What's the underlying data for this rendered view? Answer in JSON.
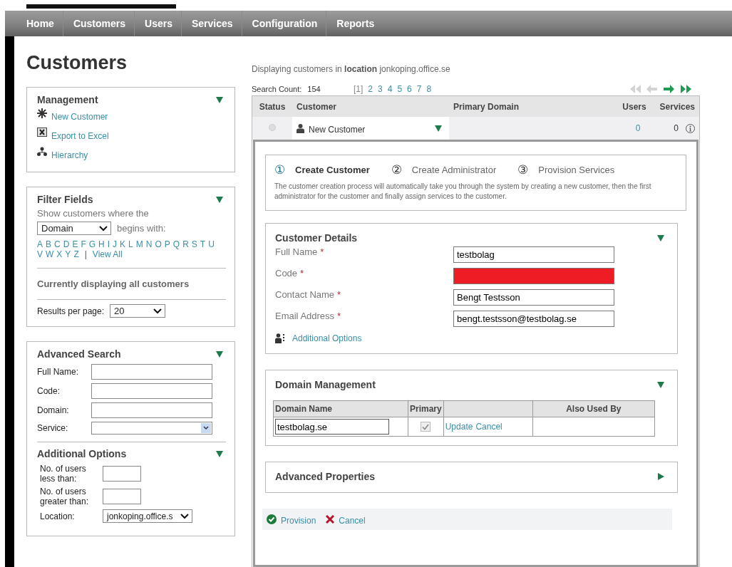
{
  "nav": {
    "items": [
      {
        "label": "Home"
      },
      {
        "label": "Customers"
      },
      {
        "label": "Users"
      },
      {
        "label": "Services"
      },
      {
        "label": "Configuration"
      },
      {
        "label": "Reports"
      }
    ]
  },
  "page_title": "Customers",
  "management": {
    "title": "Management",
    "expanded": true,
    "items": [
      {
        "label": "New Customer",
        "kind": "new"
      },
      {
        "label": "Export to Excel",
        "kind": "excel"
      },
      {
        "label": "Hierarchy",
        "kind": "hierarchy"
      }
    ]
  },
  "filter": {
    "title": "Filter Fields",
    "expanded": true,
    "intro": "Show customers where the",
    "field": "Domain",
    "condition": "begins with:",
    "letters": [
      "A",
      "B",
      "C",
      "D",
      "E",
      "F",
      "G",
      "H",
      "I",
      "J",
      "K",
      "L",
      "M",
      "N",
      "O",
      "P",
      "Q",
      "R",
      "S",
      "T",
      "U",
      "V",
      "W",
      "X",
      "Y",
      "Z"
    ],
    "separator": "|",
    "view_all": "View All",
    "status": "Currently displaying all customers",
    "results_label": "Results per page:",
    "results_value": "20"
  },
  "advanced_search": {
    "title": "Advanced Search",
    "expanded": true,
    "fields": [
      {
        "label": "Full Name:",
        "kind": "text"
      },
      {
        "label": "Code:",
        "kind": "text"
      },
      {
        "label": "Domain:",
        "kind": "text"
      },
      {
        "label": "Service:",
        "kind": "select"
      }
    ],
    "additional": {
      "title": "Additional Options",
      "expanded": true,
      "fields": [
        {
          "label": "No. of users less than:",
          "kind": "small"
        },
        {
          "label": "No. of users greater than:",
          "kind": "small"
        },
        {
          "label": "Location:",
          "kind": "select",
          "value": "jonkoping.office.s"
        }
      ]
    }
  },
  "location_text": "Displaying customers in **location** jonkoping.office.se",
  "search_count": {
    "label": "Search Count:",
    "value": "154"
  },
  "pages": [
    {
      "label": "[1]",
      "selected": true
    },
    {
      "label": "2",
      "selected": false
    },
    {
      "label": "3",
      "selected": false
    },
    {
      "label": "4",
      "selected": false
    },
    {
      "label": "5",
      "selected": false
    },
    {
      "label": "6",
      "selected": false
    },
    {
      "label": "7",
      "selected": false
    },
    {
      "label": "8",
      "selected": false
    }
  ],
  "pager": [
    {
      "kind": "first",
      "disabled": true
    },
    {
      "kind": "prev",
      "disabled": true
    },
    {
      "kind": "next",
      "disabled": false
    },
    {
      "kind": "last",
      "disabled": false
    }
  ],
  "table": {
    "columns": [
      "Status",
      "Customer",
      "Primary Domain",
      "Users",
      "Services"
    ],
    "rows": [
      {
        "active": false,
        "customer": "New Customer",
        "expanded": true,
        "users": "0",
        "services": "0"
      }
    ]
  },
  "wizard": {
    "steps": [
      {
        "number": "①",
        "label": "Create Customer",
        "selected": true
      },
      {
        "number": "②",
        "label": "Create Administrator",
        "selected": false
      },
      {
        "number": "③",
        "label": "Provision Services",
        "selected": false
      }
    ],
    "description": "The customer creation process will automatically take you through the system by creating a new customer, then the first administrator for the customer and finally assign services to the customer."
  },
  "customer_details": {
    "title": "Customer Details",
    "expanded": true,
    "fields": [
      {
        "label": "Full Name",
        "required": "*",
        "value": "testbolag",
        "invalid": false
      },
      {
        "label": "Code",
        "required": "*",
        "invalid": true
      },
      {
        "label": "Contact Name",
        "required": "*",
        "value": "Bengt Testsson",
        "invalid": false
      },
      {
        "label": "Email Address",
        "required": "*",
        "value": "bengt.testsson@testbolag.se",
        "invalid": false
      }
    ],
    "additional_link": "Additional Options"
  },
  "domain_management": {
    "title": "Domain Management",
    "expanded": true,
    "columns": [
      {
        "label": "Domain Name"
      },
      {
        "label": "Primary"
      },
      {},
      {
        "label": "Also Used By"
      }
    ],
    "rows": [
      {
        "domain": "testbolag.se",
        "primary": true,
        "actions": [
          "Update",
          "Cancel"
        ]
      }
    ]
  },
  "advanced_properties": {
    "title": "Advanced Properties",
    "expanded": false
  },
  "actions": [
    {
      "label": "Provision",
      "kind": "confirm"
    },
    {
      "label": "Cancel",
      "kind": "cancel"
    }
  ]
}
